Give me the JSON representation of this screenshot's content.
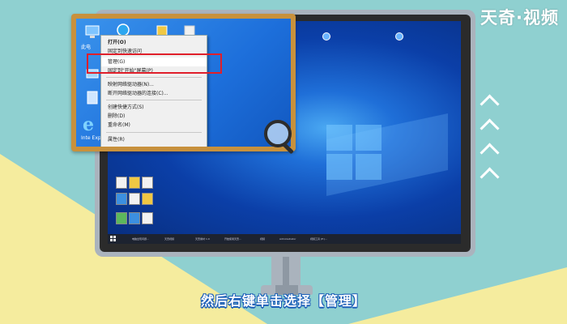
{
  "watermark": "天奇·视频",
  "caption": "然后右键单击选择【管理】",
  "context_menu": {
    "items": [
      {
        "label": "打开(O)",
        "bold": true
      },
      {
        "label": "固定到快速访问",
        "bold": false
      },
      {
        "label": "管理(G)",
        "bold": false,
        "highlighted": true
      },
      {
        "label": "固定到\"开始\"屏幕(P)",
        "bold": false
      },
      {
        "label": "映射网络驱动器(N)...",
        "bold": false
      },
      {
        "label": "断开网络驱动器的连接(C)...",
        "bold": false
      },
      {
        "label": "创建快捷方式(S)",
        "bold": false
      },
      {
        "label": "删除(D)",
        "bold": false
      },
      {
        "label": "重命名(M)",
        "bold": false
      },
      {
        "label": "属性(R)",
        "bold": false
      }
    ]
  },
  "desktop": {
    "ie_label": "Inte Explo",
    "pc_label": "此电"
  },
  "taskbar": {
    "items": [
      "电脑出现问题...",
      "天奇视频",
      "天奇素材 1.0",
      "开始使用天奇...",
      "视频",
      "Administrator",
      "视频工具 (E:)..."
    ]
  },
  "colors": {
    "frame": "#c8913c",
    "highlight_box": "#e01f2a",
    "caption_outline": "#1c5fb8"
  }
}
